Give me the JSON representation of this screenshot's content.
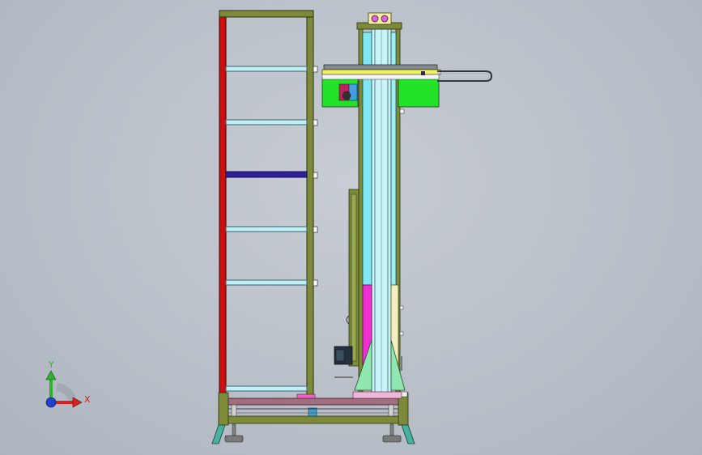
{
  "viewport": {
    "background_top": "#c8cdd4",
    "background_bottom": "#aeb5bf"
  },
  "triad": {
    "x_label": "X",
    "y_label": "Y",
    "x_color": "#d82020",
    "y_color": "#30b030",
    "z_color": "#2040d0"
  },
  "components": {
    "rack_frame": "storage-rack",
    "lift_column": "vertical-lift-column",
    "carriage": "top-carriage-assembly",
    "base": "base-frame"
  },
  "colors": {
    "frame_red": "#cc1010",
    "frame_olive": "#7c8a3a",
    "shelf_cyan": "#bff0f4",
    "shelf_blue": "#3020a0",
    "column_cyan": "#7fe8f0",
    "column_magenta": "#f030d0",
    "column_cream": "#f3efc0",
    "carriage_green": "#22e22a",
    "base_mauve": "#a07080",
    "foot_teal": "#48b0a0"
  }
}
